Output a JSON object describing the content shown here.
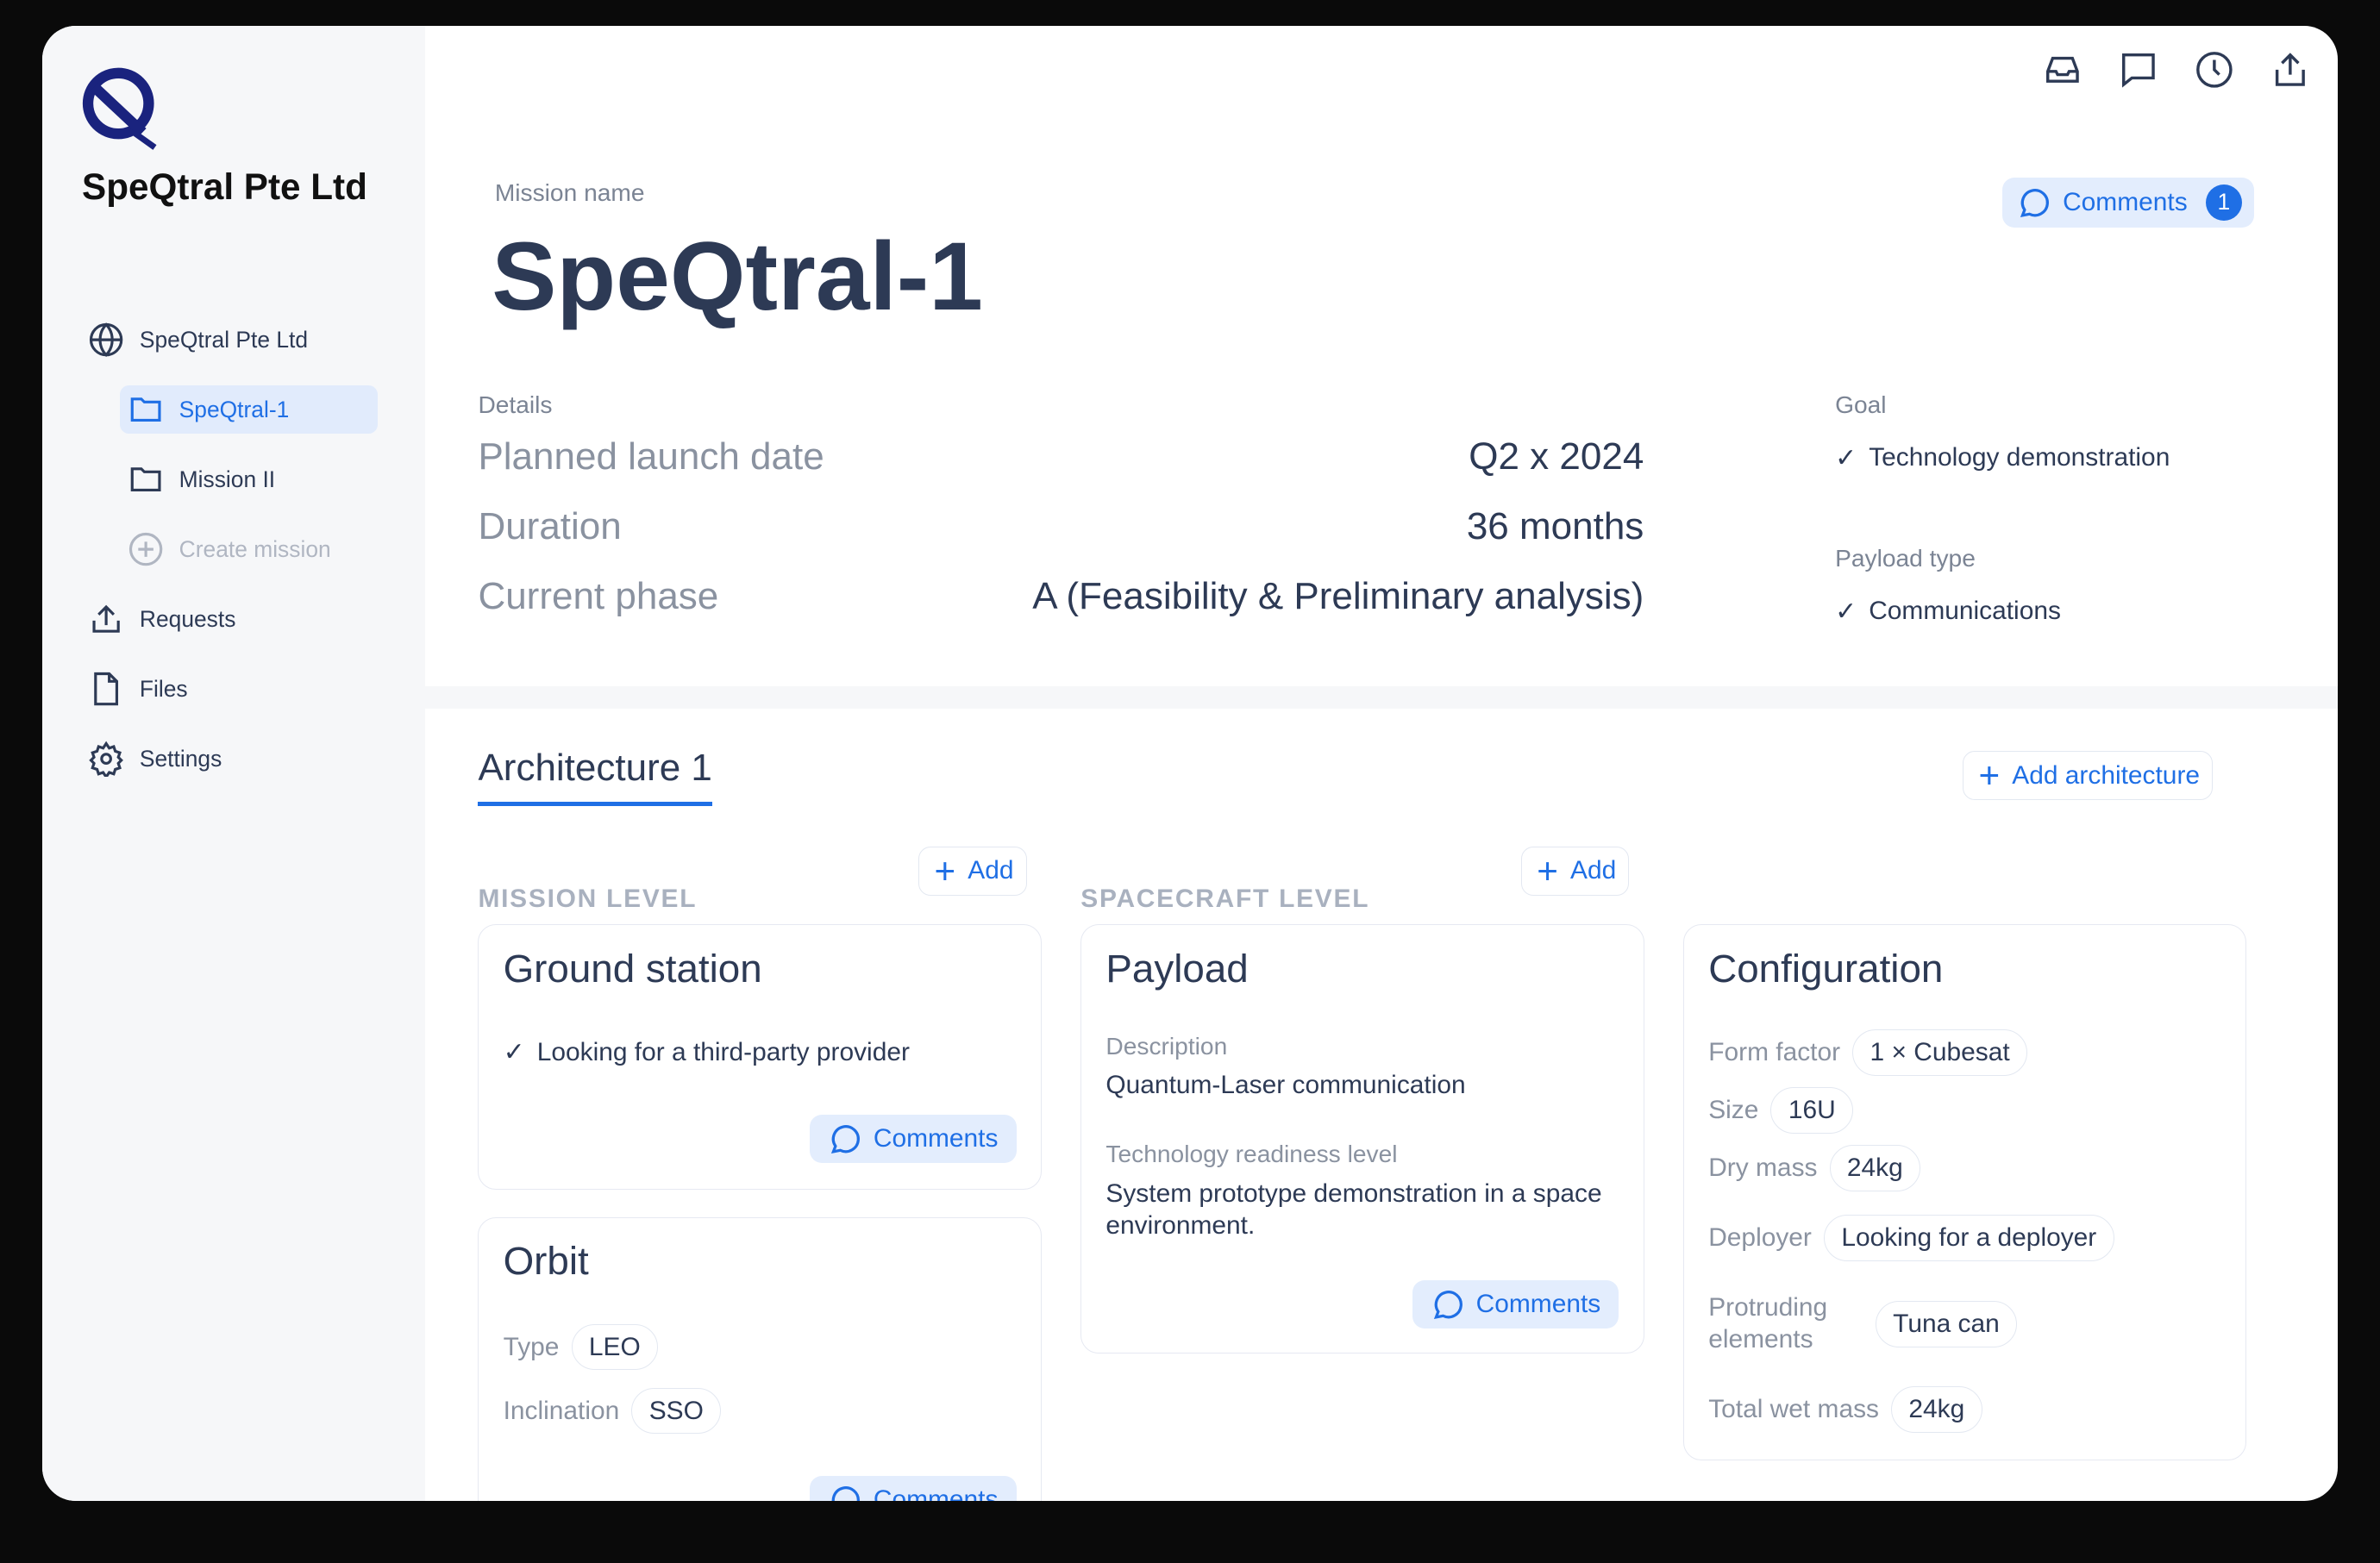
{
  "sidebar": {
    "org_name": "SpeQtral Pte Ltd",
    "items": [
      {
        "label": "SpeQtral Pte Ltd",
        "icon": "globe-icon"
      },
      {
        "label": "SpeQtral-1",
        "icon": "folder-icon",
        "active": true
      },
      {
        "label": "Mission II",
        "icon": "folder-icon"
      },
      {
        "label": "Create mission",
        "icon": "plus-circle-icon"
      },
      {
        "label": "Requests",
        "icon": "upload-icon"
      },
      {
        "label": "Files",
        "icon": "file-icon"
      },
      {
        "label": "Settings",
        "icon": "gear-icon"
      }
    ]
  },
  "toolbar": {
    "icons": [
      "inbox-icon",
      "chat-icon",
      "clock-icon",
      "share-icon"
    ]
  },
  "header": {
    "mission_label": "Mission name",
    "title": "SpeQtral-1",
    "comments_label": "Comments",
    "comments_count": "1"
  },
  "details": {
    "label": "Details",
    "rows": [
      {
        "key": "Planned launch date",
        "value": "Q2 x 2024"
      },
      {
        "key": "Duration",
        "value": "36 months"
      },
      {
        "key": "Current phase",
        "value": "A (Feasibility & Preliminary analysis)"
      }
    ],
    "goal_label": "Goal",
    "goal": "Technology demonstration",
    "payload_type_label": "Payload type",
    "payload_type": "Communications"
  },
  "architecture": {
    "tab": "Architecture 1",
    "add_architecture": "Add architecture",
    "mission_level": "MISSION LEVEL",
    "spacecraft_level": "SPACECRAFT LEVEL",
    "add": "Add",
    "comments": "Comments",
    "ground_station": {
      "title": "Ground station",
      "item": "Looking for a third-party provider"
    },
    "orbit": {
      "title": "Orbit",
      "type_label": "Type",
      "type": "LEO",
      "inclination_label": "Inclination",
      "inclination": "SSO"
    },
    "payload": {
      "title": "Payload",
      "description_label": "Description",
      "description": "Quantum-Laser communication",
      "trl_label": "Technology readiness level",
      "trl": "System prototype demonstration in a space environment."
    },
    "configuration": {
      "title": "Configuration",
      "rows": [
        {
          "key": "Form factor",
          "value": "1 × Cubesat"
        },
        {
          "key": "Size",
          "value": "16U"
        },
        {
          "key": "Dry mass",
          "value": "24kg"
        },
        {
          "key": "Deployer",
          "value": "Looking for a deployer"
        },
        {
          "key": "Protruding elements",
          "value": "Tuna can"
        },
        {
          "key": "Total wet mass",
          "value": "24kg"
        }
      ]
    }
  },
  "colors": {
    "accent": "#1f6fe5",
    "text": "#2d3a55",
    "logo": "#1a237e"
  }
}
